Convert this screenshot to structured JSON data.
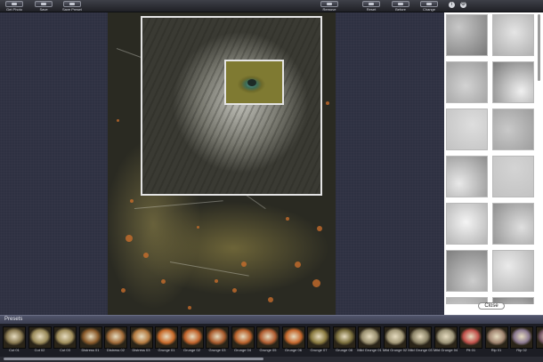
{
  "toolbar": {
    "get_photo": "Get Photo",
    "save": "Save",
    "save_preset": "Save Preset",
    "remove": "Remove",
    "reset": "Reset",
    "before": "Before",
    "change": "Change",
    "info_icon": "i",
    "settings_icon": "⚙"
  },
  "texture_panel": {
    "close_label": "Close"
  },
  "presets": {
    "title": "Presets",
    "items": [
      {
        "label": "Cut 01",
        "color": "#8a7a52"
      },
      {
        "label": "Cut 02",
        "color": "#9a8a5a"
      },
      {
        "label": "Cut 03",
        "color": "#a08e5c"
      },
      {
        "label": "Distress 01",
        "color": "#8a5a2a"
      },
      {
        "label": "Distress 02",
        "color": "#a06a38"
      },
      {
        "label": "Distress 03",
        "color": "#b47a40"
      },
      {
        "label": "Grunge 01",
        "color": "#c86a2a"
      },
      {
        "label": "Grunge 02",
        "color": "#c0622a"
      },
      {
        "label": "Grunge 03",
        "color": "#a85a2c"
      },
      {
        "label": "Grunge 04",
        "color": "#b8602a"
      },
      {
        "label": "Grunge 05",
        "color": "#b05c30"
      },
      {
        "label": "Grunge 06",
        "color": "#c4662c"
      },
      {
        "label": "Grunge 07",
        "color": "#8a7a40"
      },
      {
        "label": "Grunge 08",
        "color": "#7a6e3c"
      },
      {
        "label": "Mild Grunge 01",
        "color": "#9a9070"
      },
      {
        "label": "Mild Grunge 02",
        "color": "#a29878"
      },
      {
        "label": "Mild Grunge 03",
        "color": "#8c8468"
      },
      {
        "label": "Mild Grunge 04",
        "color": "#9c9478"
      },
      {
        "label": "Pit 01",
        "color": "#c0504a"
      },
      {
        "label": "Rip 01",
        "color": "#a08470"
      },
      {
        "label": "Rip 02",
        "color": "#8a7890"
      },
      {
        "label": "Rip",
        "color": "#7a5a6a"
      }
    ]
  },
  "colors": {
    "accent_splat": "#d0702c",
    "frame": "#e4e4e4"
  }
}
